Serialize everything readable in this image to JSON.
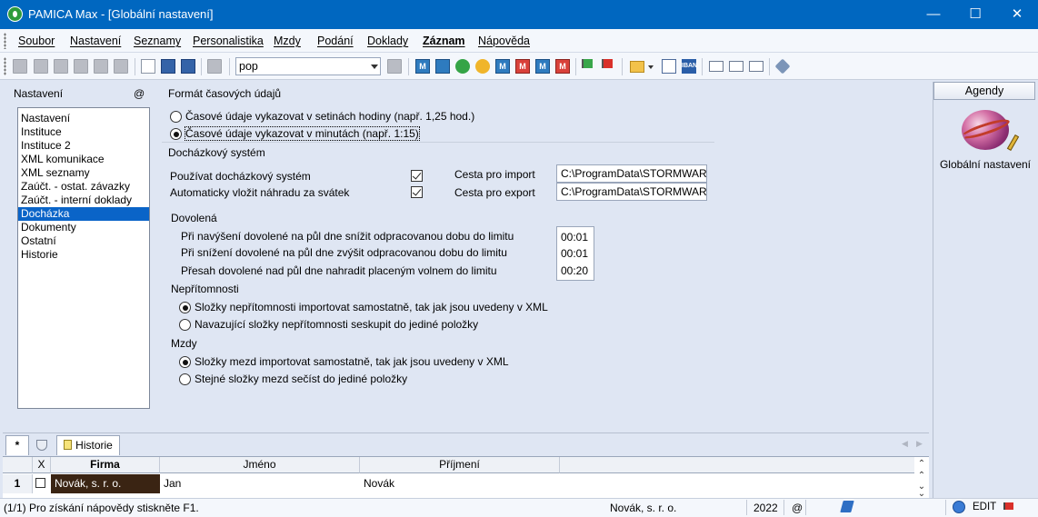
{
  "window": {
    "title": "PAMICA Max - [Globální nastavení]",
    "minimize_glyph": "—",
    "maximize_glyph": "☐",
    "close_glyph": "✕"
  },
  "menu": {
    "items": [
      "Soubor",
      "Nastavení",
      "Seznamy",
      "Personalistika",
      "Mzdy",
      "Podání",
      "Doklady",
      "Záznam",
      "Nápověda"
    ]
  },
  "toolbar": {
    "search_value": "pop",
    "m_label": "M"
  },
  "left_panel": {
    "title": "Nastavení",
    "at_symbol": "@",
    "items": [
      "Nastavení",
      "Instituce",
      "Instituce 2",
      "XML komunikace",
      "XML seznamy",
      "Zaúčt. - ostat. závazky",
      "Zaúčt. - interní doklady",
      "Docházka",
      "Dokumenty",
      "Ostatní",
      "Historie"
    ],
    "selected_index": 7
  },
  "content": {
    "time_format": {
      "title": "Formát časových údajů",
      "options": [
        "Časové údaje vykazovat v setinách hodiny (např. 1,25 hod.)",
        "Časové údaje vykazovat v minutách (např. 1:15)"
      ],
      "selected_index": 1
    },
    "attendance": {
      "title": "Docházkový systém",
      "use_system_label": "Používat docházkový systém",
      "use_system_checked": true,
      "auto_holiday_label": "Automaticky vložit náhradu za svátek",
      "auto_holiday_checked": true,
      "import_path_label": "Cesta pro import",
      "import_path_value": "C:\\ProgramData\\STORMWARE",
      "export_path_label": "Cesta pro export",
      "export_path_value": "C:\\ProgramData\\STORMWARE"
    },
    "vacation": {
      "title": "Dovolená",
      "rows": [
        {
          "label": "Při navýšení dovolené na půl dne snížit odpracovanou dobu do limitu",
          "value": "00:01"
        },
        {
          "label": "Při snížení dovolené na půl dne zvýšit odpracovanou dobu do limitu",
          "value": "00:01"
        },
        {
          "label": "Přesah dovolené nad půl dne nahradit placeným volnem do limitu",
          "value": "00:20"
        }
      ]
    },
    "absence": {
      "title": "Nepřítomnosti",
      "options": [
        "Složky nepřítomnosti importovat samostatně, tak jak jsou uvedeny v XML",
        "Navazující složky nepřítomnosti seskupit do jediné položky"
      ],
      "selected_index": 0
    },
    "wages": {
      "title": "Mzdy",
      "options": [
        "Složky mezd importovat samostatně, tak jak jsou uvedeny v XML",
        "Stejné složky mezd sečíst do jediné položky"
      ],
      "selected_index": 0
    }
  },
  "agendy": {
    "header": "Agendy",
    "item_label": "Globální nastavení"
  },
  "bottom": {
    "tabs": {
      "star": "*",
      "history": "Historie"
    },
    "columns": {
      "x": "X",
      "firma": "Firma",
      "jmeno": "Jméno",
      "prijmeni": "Příjmení"
    },
    "rows": [
      {
        "num": "1",
        "firma": "Novák, s. r. o.",
        "jmeno": "Jan",
        "prijmeni": "Novák"
      }
    ]
  },
  "statusbar": {
    "help": "(1/1) Pro získání nápovědy stiskněte F1.",
    "company": "Novák, s. r. o.",
    "year": "2022",
    "at": "@",
    "mode": "EDIT"
  },
  "colors": {
    "titlebar": "#0067c0",
    "selection": "#0a64c8",
    "panel_bg": "#dfe6f3",
    "firma_cell": "#3a2413"
  }
}
